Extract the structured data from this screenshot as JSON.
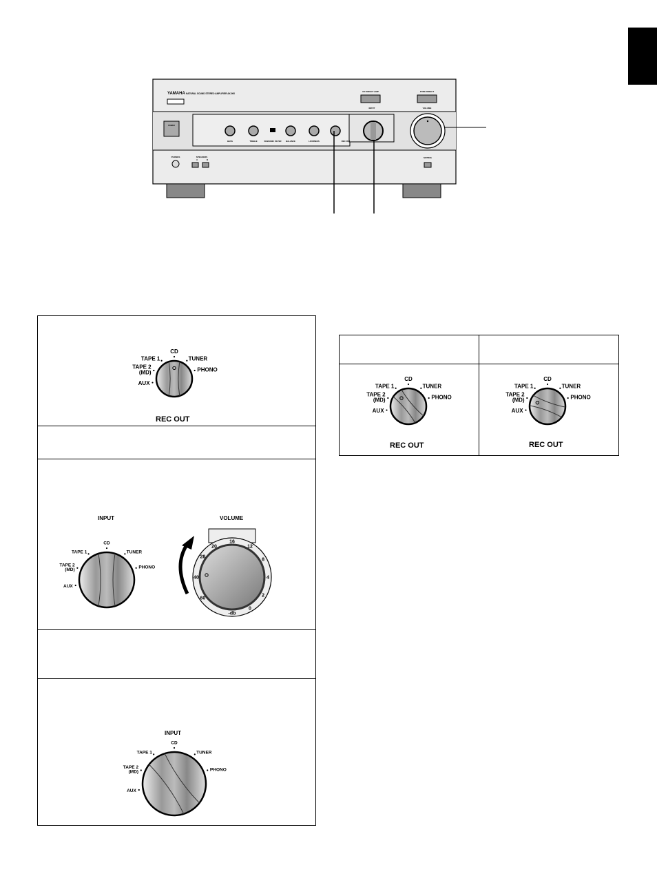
{
  "amplifier": {
    "brand": "YAMAHA",
    "model": "NATURAL SOUND STEREO AMPLIFIER AX-900",
    "cd_direct": "CD DIRECT AMP",
    "pure_direct": "PURE DIRECT",
    "input": "INPUT",
    "volume": "VOLUME",
    "power": "POWER",
    "controls": [
      "BASS",
      "TREBLE",
      "SUBSONIC FILTER",
      "BALANCE",
      "LOUDNESS",
      "REC OUT"
    ],
    "phones": "PHONES",
    "speakers": "SPEAKERS",
    "speaker_a": "A",
    "speaker_b": "B",
    "muting": "MUTING"
  },
  "knob_labels": {
    "tape1": "TAPE 1",
    "cd": "CD",
    "tuner": "TUNER",
    "tape2": "TAPE 2",
    "md": "(MD)",
    "phono": "PHONO",
    "aux": "AUX"
  },
  "rec_out_label": "REC OUT",
  "input_label": "INPUT",
  "volume_label": "VOLUME",
  "volume_scale": [
    "20",
    "16",
    "12",
    "28",
    "8",
    "40",
    "4",
    "60",
    "2",
    "0",
    "-db"
  ],
  "colors": {
    "tab": "#000000",
    "panel": "#e8e8e8"
  }
}
